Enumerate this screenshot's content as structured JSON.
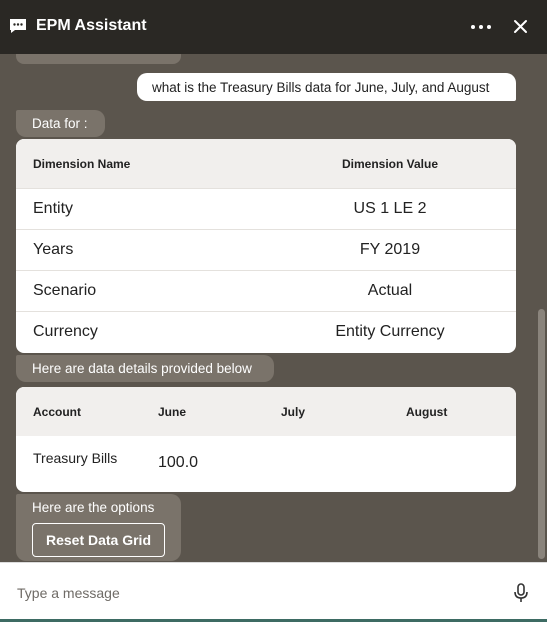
{
  "header": {
    "title": "EPM Assistant"
  },
  "conversation": {
    "user_message": "what is the Treasury Bills data for June, July, and August",
    "data_for_label": "Data for :",
    "dimension_table": {
      "headers": [
        "Dimension Name",
        "Dimension Value"
      ],
      "rows": [
        [
          "Entity",
          "US 1 LE 2"
        ],
        [
          "Years",
          "FY 2019"
        ],
        [
          "Scenario",
          "Actual"
        ],
        [
          "Currency",
          "Entity Currency"
        ]
      ]
    },
    "details_label": "Here are data details provided below",
    "account_table": {
      "headers": [
        "Account",
        "June",
        "July",
        "August"
      ],
      "rows": [
        [
          "Treasury Bills",
          "100.0",
          "",
          ""
        ]
      ]
    },
    "options_label": "Here are the options",
    "reset_button": "Reset Data Grid"
  },
  "input": {
    "placeholder": "Type a message"
  },
  "icons": {
    "chat": "chat-bubble-icon",
    "more": "more-options-icon",
    "close": "close-icon",
    "mic": "microphone-icon"
  },
  "colors": {
    "header_bg": "#2a2824",
    "chat_bg": "#5b554d",
    "bot_bubble": "#7a736a"
  }
}
